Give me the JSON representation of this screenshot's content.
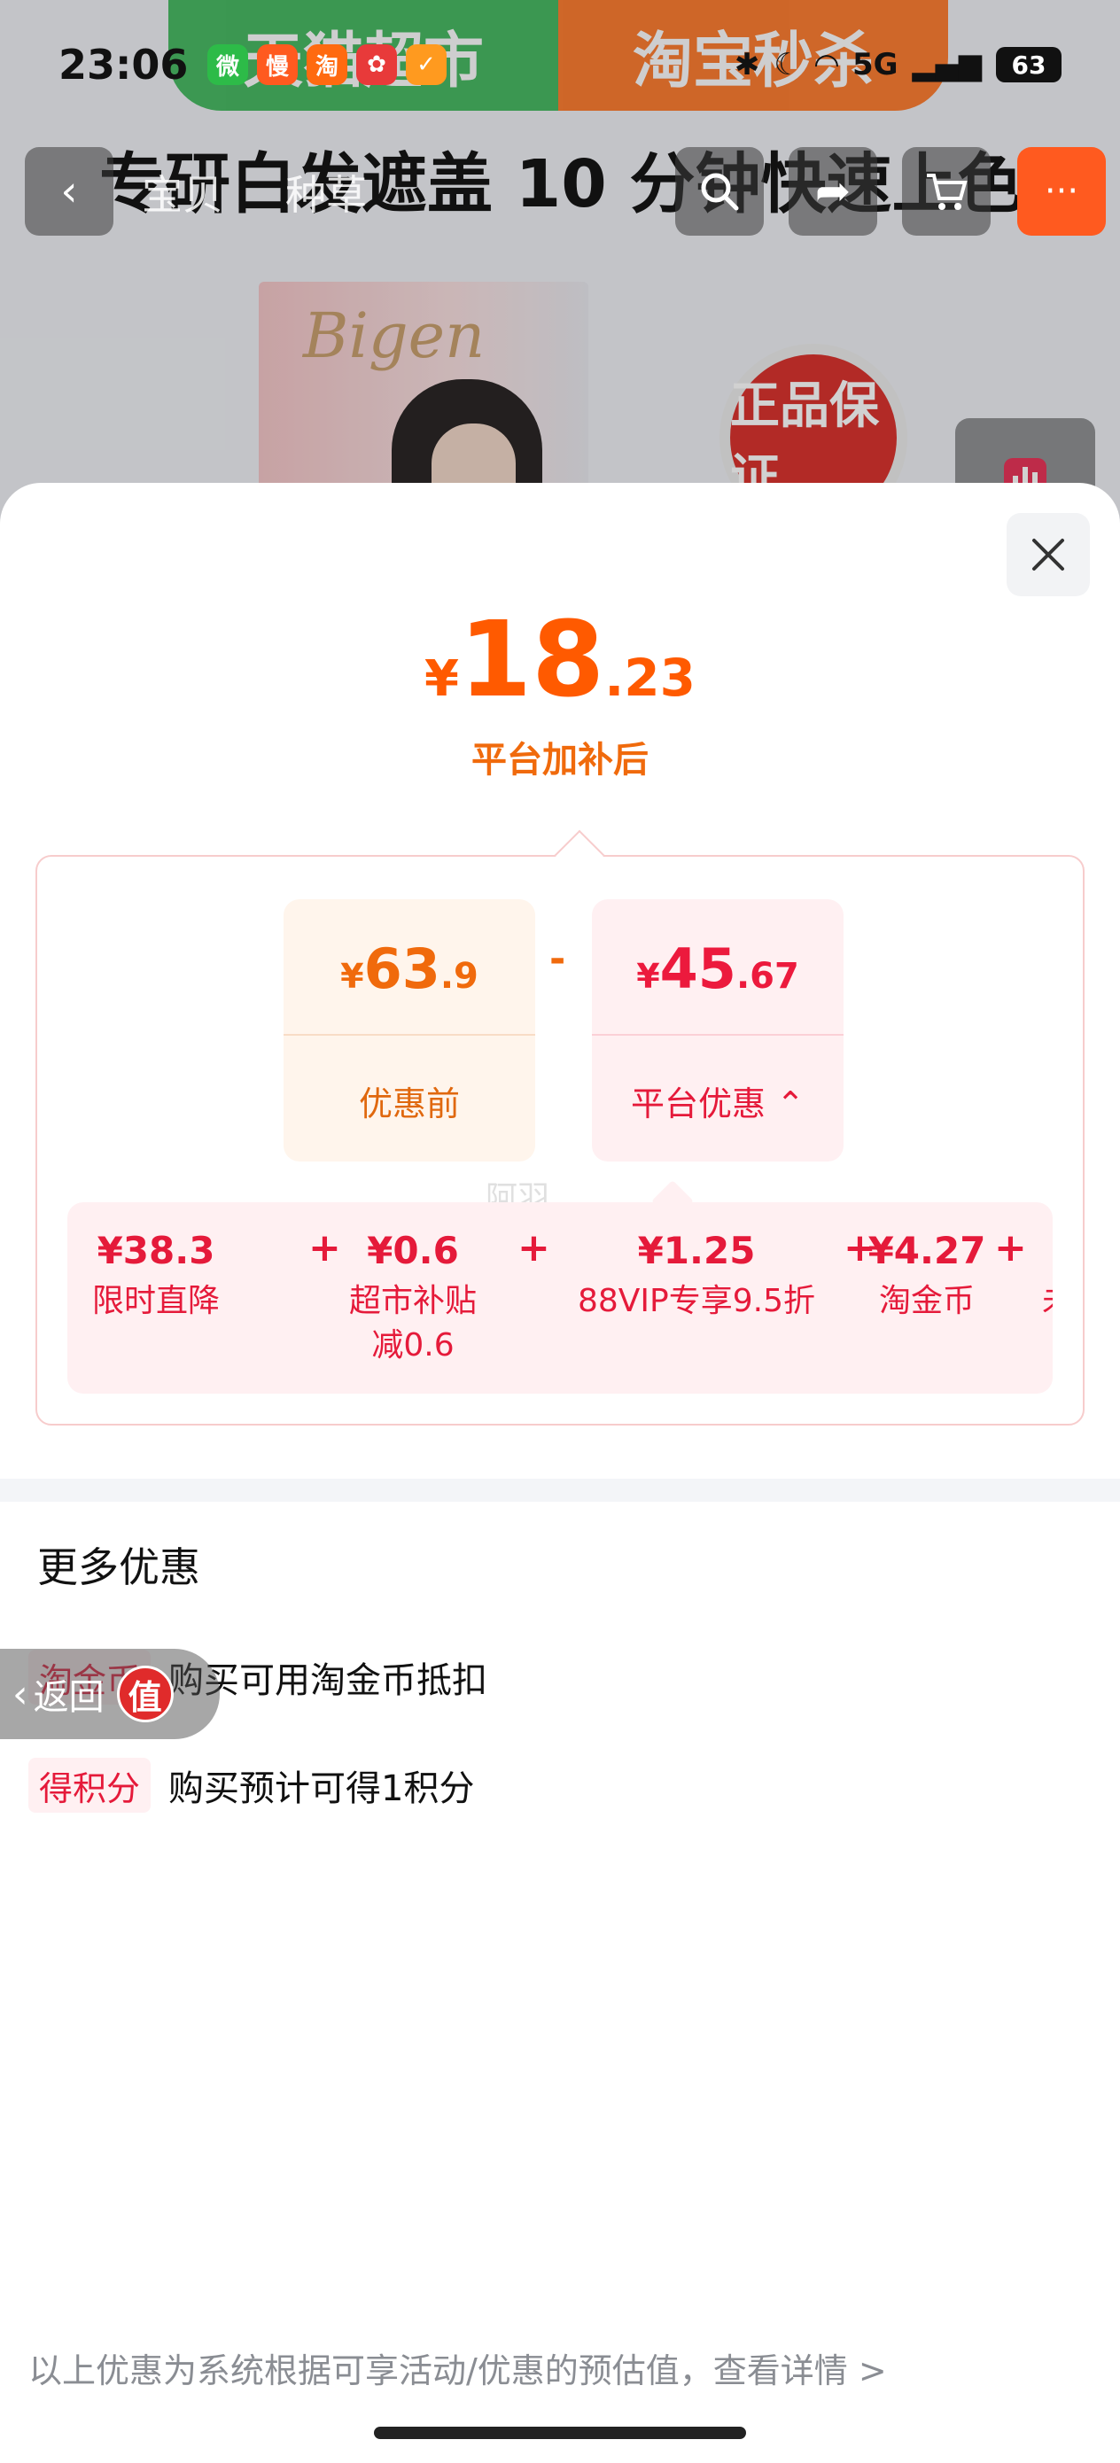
{
  "status_bar": {
    "time": "23:06",
    "apps": [
      {
        "icon": "wechat-icon",
        "color": "#2dbb48",
        "glyph": "微"
      },
      {
        "icon": "app-man-icon",
        "color": "#ff5a1f",
        "glyph": "慢"
      },
      {
        "icon": "taobao-icon",
        "color": "#ff6a10",
        "glyph": "淘"
      },
      {
        "icon": "cartoon-app-icon",
        "color": "#e83a3a",
        "glyph": "✿"
      },
      {
        "icon": "check-app-icon",
        "color": "#ff9a1f",
        "glyph": "✓"
      }
    ],
    "network": "5G",
    "battery": "63"
  },
  "background": {
    "banner_left": "天猫超市",
    "banner_right": "淘宝秒杀",
    "product_title": "专研白发遮盖 10 分钟快速上色",
    "nav_tabs": [
      "宝贝",
      "种草"
    ],
    "nav_more": "···",
    "box_brand": "Bigen",
    "seal_text": "正品保证"
  },
  "sheet": {
    "final_price": {
      "currency": "¥",
      "integer": "18",
      "decimal": ".23"
    },
    "final_label": "平台加补后",
    "before": {
      "currency": "¥",
      "integer": "63",
      "decimal": ".9",
      "label": "优惠前"
    },
    "operator": "-",
    "discount": {
      "currency": "¥",
      "integer": "45",
      "decimal": ".67",
      "label": "平台优惠",
      "chevron": "⌃"
    },
    "watermark": "阿羽_",
    "breakdown": [
      {
        "value": "¥38.3",
        "name": "限时直降"
      },
      {
        "value": "¥0.6",
        "name": "超市补贴\n减0.6"
      },
      {
        "value": "¥1.25",
        "name": "88VIP专享9.5折"
      },
      {
        "value": "¥4.27",
        "name": "淘金币"
      }
    ],
    "plus": "+",
    "truncated_next": "未",
    "more_title": "更多优惠",
    "promos": [
      {
        "tag": "淘金币",
        "text": "购买可用淘金币抵扣"
      },
      {
        "tag": "得积分",
        "text": "购买预计可得1积分"
      }
    ],
    "footnote": "以上优惠为系统根据可享活动/优惠的预估值，查看详情 >"
  },
  "float_back": {
    "label": "返回",
    "badge": "值"
  },
  "colors": {
    "accent_orange": "#ff5a00",
    "accent_red": "#e51a3a"
  }
}
